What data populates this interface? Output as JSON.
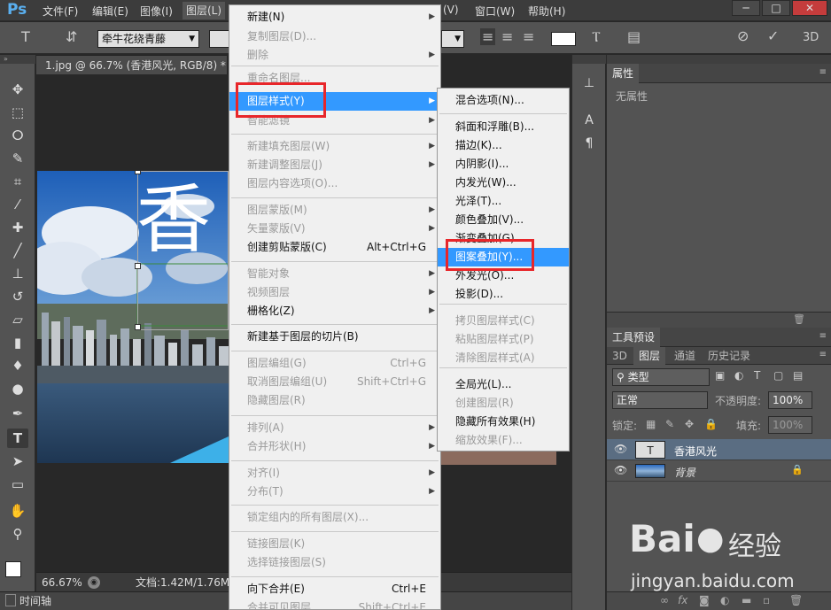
{
  "menubar": {
    "logo": "Ps",
    "items": [
      "文件(F)",
      "编辑(E)",
      "图像(I)",
      "图层(L)",
      "(V)",
      "窗口(W)",
      "帮助(H)"
    ],
    "window_buttons": [
      "─",
      "□",
      "✕"
    ]
  },
  "options": {
    "font_family": "牵牛花绕青藤",
    "three_d": "3D"
  },
  "document": {
    "tab_title": "1.jpg @ 66.7% (香港风光, RGB/8) *",
    "zoom": "66.67%",
    "doc_size": "文档:1.42M/1.76M",
    "timeline": "时间轴",
    "overlay_char": "香"
  },
  "properties": {
    "tab": "属性",
    "none": "无属性"
  },
  "tool_preset": {
    "label": "工具预设"
  },
  "layers_panel": {
    "tabs": [
      "3D",
      "图层",
      "通道",
      "历史记录"
    ],
    "filter": "类型",
    "blend_mode": "正常",
    "opacity_label": "不透明度:",
    "opacity": "100%",
    "lock_label": "锁定:",
    "fill_label": "填充:",
    "fill": "100%",
    "layers": [
      {
        "name": "香港风光",
        "type": "T"
      },
      {
        "name": "背景"
      }
    ]
  },
  "layer_menu": {
    "items": [
      {
        "label": "新建(N)",
        "arrow": true,
        "disabled": false
      },
      {
        "label": "复制图层(D)...",
        "disabled": true
      },
      {
        "label": "删除",
        "arrow": true,
        "disabled": true
      },
      {
        "label": "重命名图层...",
        "disabled": true
      },
      {
        "label": "图层样式(Y)",
        "arrow": true,
        "highlight": true
      },
      {
        "label": "智能滤镜",
        "arrow": true,
        "disabled": true
      },
      {
        "label": "新建填充图层(W)",
        "arrow": true,
        "disabled": true
      },
      {
        "label": "新建调整图层(J)",
        "arrow": true,
        "disabled": true
      },
      {
        "label": "图层内容选项(O)...",
        "disabled": true
      },
      {
        "label": "图层蒙版(M)",
        "arrow": true,
        "disabled": true
      },
      {
        "label": "矢量蒙版(V)",
        "arrow": true,
        "disabled": true
      },
      {
        "label": "创建剪贴蒙版(C)",
        "shortcut": "Alt+Ctrl+G",
        "disabled": false
      },
      {
        "label": "智能对象",
        "arrow": true,
        "disabled": true
      },
      {
        "label": "视频图层",
        "arrow": true,
        "disabled": true
      },
      {
        "label": "栅格化(Z)",
        "arrow": true,
        "disabled": false
      },
      {
        "label": "新建基于图层的切片(B)",
        "disabled": false
      },
      {
        "label": "图层编组(G)",
        "shortcut": "Ctrl+G",
        "disabled": true
      },
      {
        "label": "取消图层编组(U)",
        "shortcut": "Shift+Ctrl+G",
        "disabled": true
      },
      {
        "label": "隐藏图层(R)",
        "disabled": true
      },
      {
        "label": "排列(A)",
        "arrow": true,
        "disabled": true
      },
      {
        "label": "合并形状(H)",
        "arrow": true,
        "disabled": true
      },
      {
        "label": "对齐(I)",
        "arrow": true,
        "disabled": true
      },
      {
        "label": "分布(T)",
        "arrow": true,
        "disabled": true
      },
      {
        "label": "锁定组内的所有图层(X)...",
        "disabled": true
      },
      {
        "label": "链接图层(K)",
        "disabled": true
      },
      {
        "label": "选择链接图层(S)",
        "disabled": true
      },
      {
        "label": "向下合并(E)",
        "shortcut": "Ctrl+E",
        "disabled": false
      },
      {
        "label": "合并可见图层",
        "shortcut": "Shift+Ctrl+E",
        "disabled": true
      }
    ]
  },
  "style_submenu": {
    "items": [
      {
        "label": "混合选项(N)...",
        "disabled": false
      },
      {
        "label": "斜面和浮雕(B)...",
        "disabled": false
      },
      {
        "label": "描边(K)...",
        "disabled": false
      },
      {
        "label": "内阴影(I)...",
        "disabled": false
      },
      {
        "label": "内发光(W)...",
        "disabled": false
      },
      {
        "label": "光泽(T)...",
        "disabled": false
      },
      {
        "label": "颜色叠加(V)...",
        "disabled": false
      },
      {
        "label": "渐变叠加(G)...",
        "disabled": false
      },
      {
        "label": "图案叠加(Y)...",
        "highlight": true
      },
      {
        "label": "外发光(O)...",
        "disabled": false
      },
      {
        "label": "投影(D)...",
        "disabled": false
      },
      {
        "label": "拷贝图层样式(C)",
        "disabled": true
      },
      {
        "label": "粘贴图层样式(P)",
        "disabled": true
      },
      {
        "label": "清除图层样式(A)",
        "disabled": true
      },
      {
        "label": "全局光(L)...",
        "disabled": false
      },
      {
        "label": "创建图层(R)",
        "disabled": true
      },
      {
        "label": "隐藏所有效果(H)",
        "disabled": false
      },
      {
        "label": "缩放效果(F)...",
        "disabled": true
      }
    ]
  },
  "watermark": {
    "brand": "Bai",
    "brand2": "经验",
    "url": "jingyan.baidu.com"
  }
}
